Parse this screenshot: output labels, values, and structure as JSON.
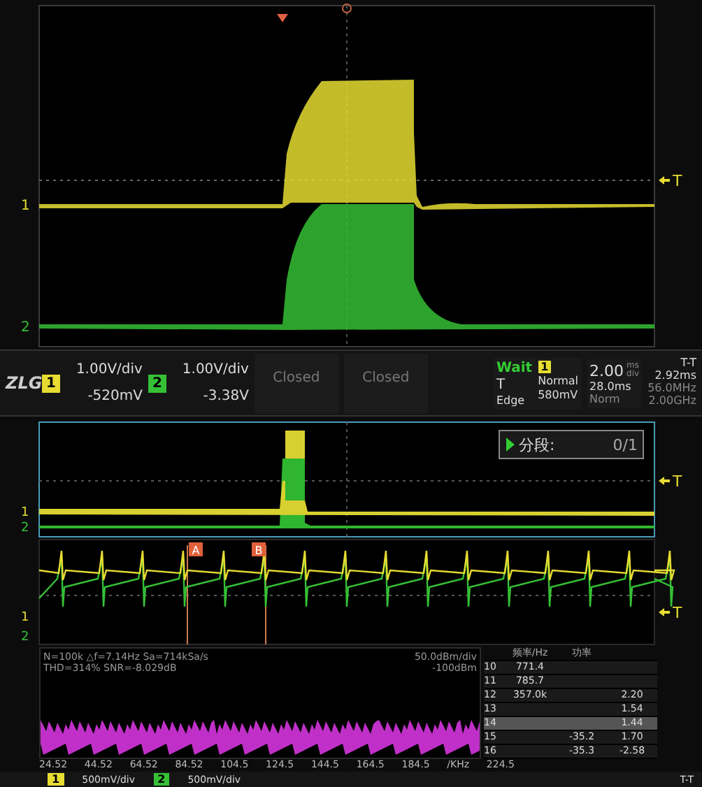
{
  "main_view": {
    "channel_markers": [
      {
        "label": "1",
        "color": "#e6dc32"
      },
      {
        "label": "2",
        "color": "#35c035"
      }
    ],
    "trigger_marker": "T"
  },
  "status_bar": {
    "logo": "ZLG",
    "channels": [
      {
        "number": "1",
        "scale": "1.00V/div",
        "offset": "-520mV",
        "color": "#e6dc32"
      },
      {
        "number": "2",
        "scale": "1.00V/div",
        "offset": "-3.38V",
        "color": "#35c035"
      }
    ],
    "math_slots": [
      "Closed",
      "Closed"
    ],
    "trigger": {
      "state": "Wait",
      "type_label": "T",
      "source": "1",
      "mode": "Normal",
      "level": "580mV",
      "edge": "Edge"
    },
    "timebase": {
      "scale": "2.00",
      "unit_top": "ms",
      "unit_bottom": "div",
      "delay": "28.0ms",
      "acq_mode": "Norm"
    },
    "measure": {
      "mode": "T-T",
      "value": "2.92ms",
      "rate": "56.0MHz",
      "bandwidth": "2.00GHz"
    }
  },
  "zoom_view": {
    "segment_label": "分段:",
    "segment_count": "0/1",
    "channel_markers": [
      "1",
      "2"
    ],
    "trigger_marker": "T"
  },
  "cursor_view": {
    "cursors": [
      "A",
      "B"
    ],
    "channel_markers": [
      "1",
      "2"
    ],
    "trigger_marker": "T"
  },
  "fft": {
    "info_lines": [
      "N=100k  △f=7.14Hz  Sa=714kSa/s",
      "THD=314%  SNR=-8.029dB"
    ],
    "scale": "50.0dBm/div",
    "reference": "-100dBm",
    "x_labels": [
      "24.52",
      "44.52",
      "64.52",
      "84.52",
      "104.5",
      "124.5",
      "144.5",
      "164.5",
      "184.5",
      "/KHz",
      "224.5"
    ]
  },
  "harmonics_table": {
    "column_headers": {
      "frequency": "频率/Hz",
      "power": "功率"
    },
    "rows": [
      {
        "index": "10",
        "frequency": "771.4",
        "selected": false
      },
      {
        "index": "11",
        "frequency": "785.7",
        "selected": false
      },
      {
        "index": "12",
        "frequency": "357.0k",
        "phase": "2.20",
        "selected": false
      },
      {
        "index": "13",
        "phase": "1.54",
        "selected": false
      },
      {
        "index": "14",
        "phase": "1.44",
        "selected": true
      },
      {
        "index": "15",
        "power": "-35.2",
        "phase": "1.70",
        "selected": false
      },
      {
        "index": "16",
        "power": "-35.3",
        "phase": "-2.58",
        "selected": false
      }
    ]
  },
  "bottom_bar": {
    "channels": [
      {
        "number": "1",
        "scale": "500mV/div",
        "color": "#e6dc32"
      },
      {
        "number": "2",
        "scale": "500mV/div",
        "color": "#35c035"
      }
    ],
    "mode": "T-T"
  }
}
